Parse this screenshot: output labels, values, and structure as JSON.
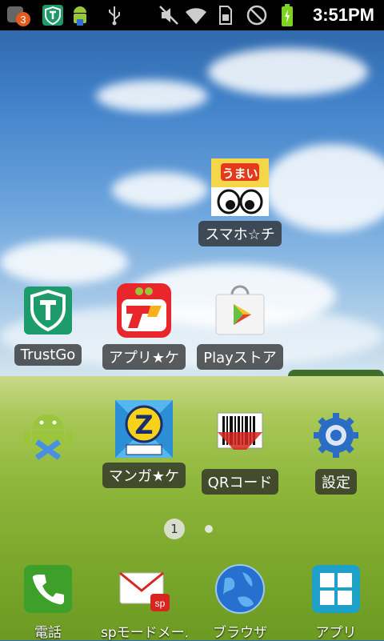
{
  "status_bar": {
    "notification_count": "3",
    "time": "3:51PM",
    "icons": [
      "notification-badge-icon",
      "trustgo-icon",
      "android-icon",
      "usb-icon",
      "mute-icon",
      "wifi-icon",
      "sim-icon",
      "no-signal-icon",
      "battery-charging-icon"
    ]
  },
  "home": {
    "apps": [
      {
        "label": "スマホ☆チ",
        "icon": "umai-icon"
      },
      {
        "label": "TrustGo",
        "icon": "trustgo-icon"
      },
      {
        "label": "アプリ★ケ",
        "icon": "appli-icon"
      },
      {
        "label": "Playストア",
        "icon": "play-store-icon"
      },
      {
        "label": "",
        "icon": "android-installer-icon"
      },
      {
        "label": "マンガ★ケ",
        "icon": "manga-icon"
      },
      {
        "label": "QRコード",
        "icon": "qr-code-icon"
      },
      {
        "label": "設定",
        "icon": "settings-icon"
      }
    ],
    "page_indicator": {
      "current": "1",
      "total": 2
    }
  },
  "dock": {
    "items": [
      {
        "label": "電話",
        "icon": "phone-icon"
      },
      {
        "label": "spモードメール",
        "icon": "mail-icon"
      },
      {
        "label": "ブラウザ",
        "icon": "browser-icon"
      },
      {
        "label": "アプリ",
        "icon": "apps-grid-icon"
      }
    ]
  }
}
